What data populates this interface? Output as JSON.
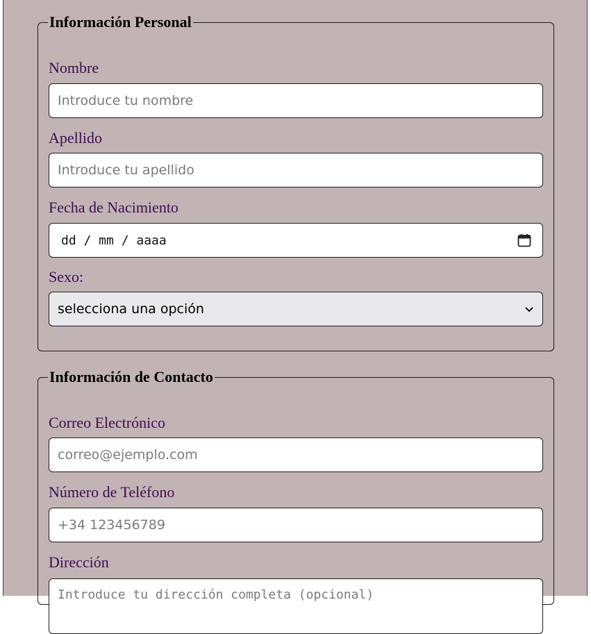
{
  "personal": {
    "legend": "Información Personal",
    "nombre": {
      "label": "Nombre",
      "placeholder": "Introduce tu nombre"
    },
    "apellido": {
      "label": "Apellido",
      "placeholder": "Introduce tu apellido"
    },
    "fecha": {
      "label": "Fecha de Nacimiento",
      "format": "dd / mm / aaaa",
      "icon": "calendar-icon"
    },
    "sexo": {
      "label": "Sexo:",
      "selected": "selecciona una opción",
      "icon": "chevron-down-icon"
    }
  },
  "contacto": {
    "legend": "Información de Contacto",
    "correo": {
      "label": "Correo Electrónico",
      "placeholder": "correo@ejemplo.com"
    },
    "telefono": {
      "label": "Número de Teléfono",
      "placeholder": "+34 123456789"
    },
    "direccion": {
      "label": "Dirección",
      "placeholder": "Introduce tu dirección completa (opcional)"
    }
  },
  "colors": {
    "background": "#c2b4b5",
    "label": "#3c0d52",
    "select_background": "#e9e8ed"
  }
}
